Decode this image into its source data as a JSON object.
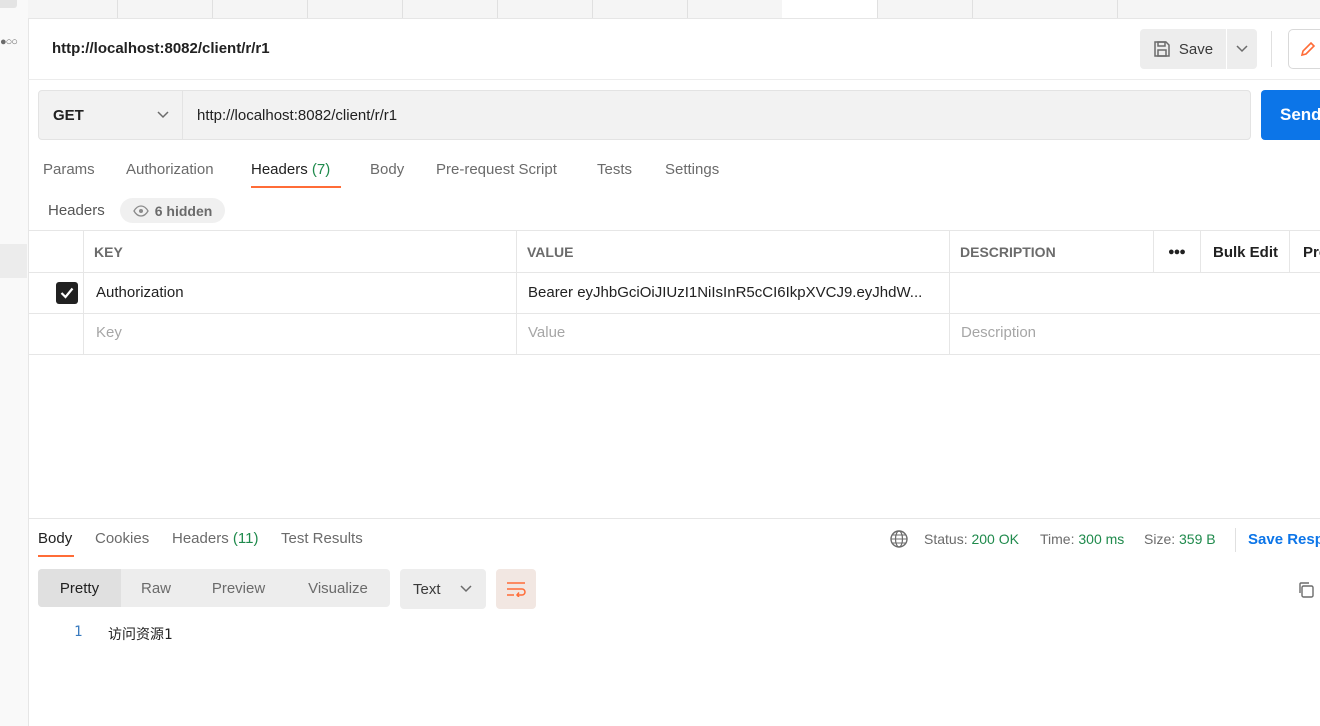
{
  "request": {
    "title": "http://localhost:8082/client/r/r1",
    "method": "GET",
    "url": "http://localhost:8082/client/r/r1",
    "save_label": "Save",
    "send_label": "Send"
  },
  "request_tabs": [
    {
      "label": "Params"
    },
    {
      "label": "Authorization"
    },
    {
      "label": "Headers",
      "count": "(7)"
    },
    {
      "label": "Body"
    },
    {
      "label": "Pre-request Script"
    },
    {
      "label": "Tests"
    },
    {
      "label": "Settings"
    }
  ],
  "headers_section": {
    "title": "Headers",
    "hidden_label": "6 hidden",
    "columns": {
      "key": "KEY",
      "value": "VALUE",
      "description": "DESCRIPTION",
      "bulk_edit": "Bulk Edit",
      "presets": "Presets"
    },
    "rows": [
      {
        "checked": true,
        "key": "Authorization",
        "value": "Bearer  eyJhbGciOiJIUzI1NiIsInR5cCI6IkpXVCJ9.eyJhdW...",
        "description": ""
      }
    ],
    "placeholders": {
      "key": "Key",
      "value": "Value",
      "description": "Description"
    }
  },
  "response": {
    "tabs": [
      {
        "label": "Body"
      },
      {
        "label": "Cookies"
      },
      {
        "label": "Headers",
        "count": "(11)"
      },
      {
        "label": "Test Results"
      }
    ],
    "status_label": "Status:",
    "status_value": "200 OK",
    "time_label": "Time:",
    "time_value": "300 ms",
    "size_label": "Size:",
    "size_value": "359 B",
    "save_response_label": "Save Response",
    "view_modes": [
      "Pretty",
      "Raw",
      "Preview",
      "Visualize"
    ],
    "format": "Text",
    "body_lines": [
      {
        "no": "1",
        "text": "访问资源1"
      }
    ]
  },
  "colors": {
    "accent": "#ff6c37",
    "primary": "#0c75e8",
    "success": "#1f8a4c"
  }
}
